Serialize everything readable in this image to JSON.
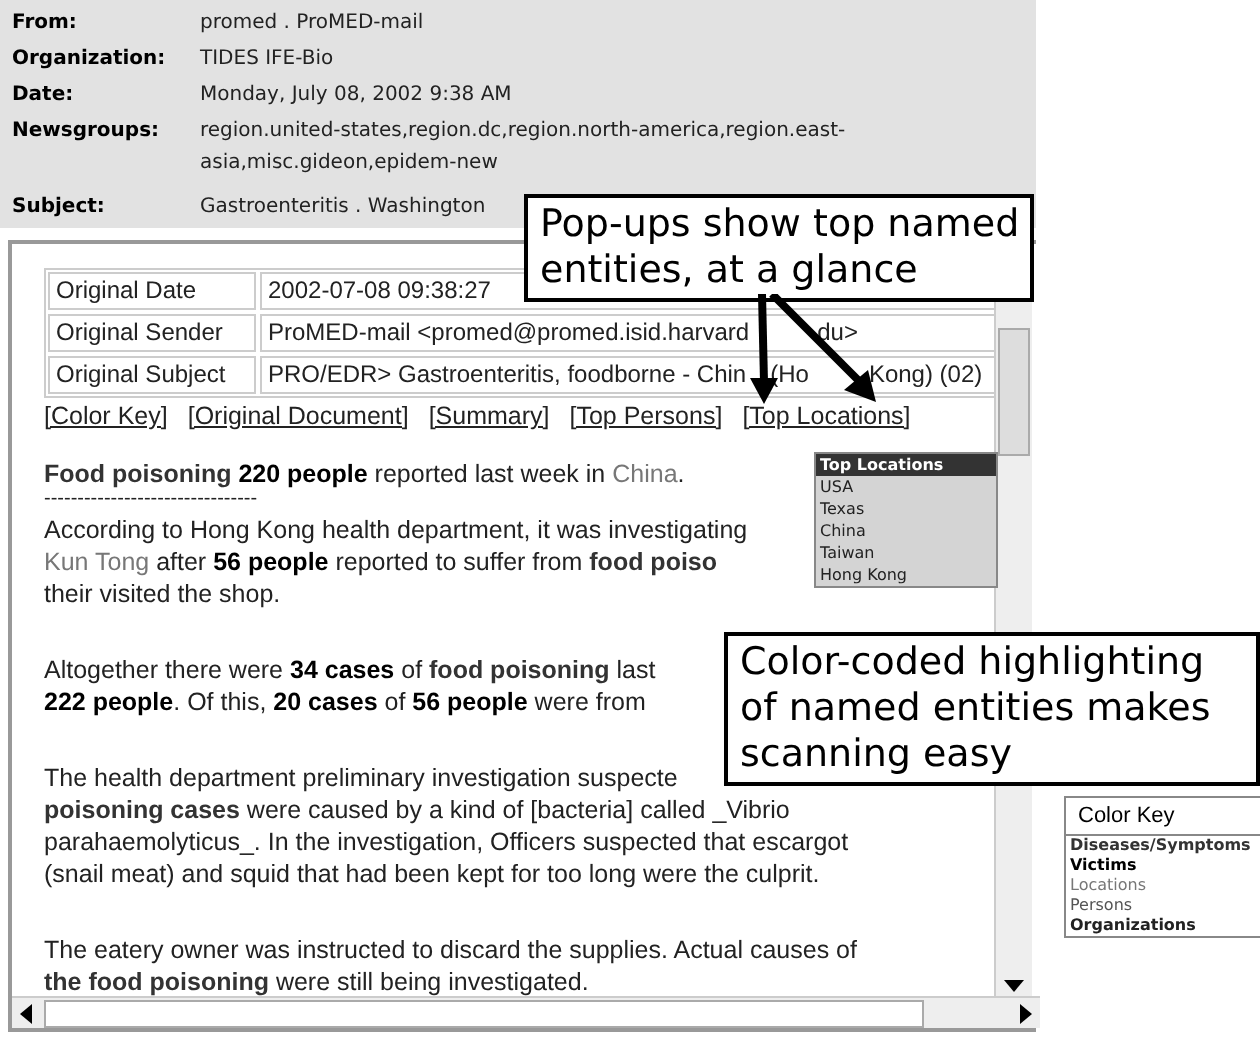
{
  "headers": [
    {
      "label": "From:",
      "lines": [
        "promed . ProMED-mail"
      ]
    },
    {
      "label": "Organization:",
      "lines": [
        "TIDES IFE-Bio"
      ]
    },
    {
      "label": "Date:",
      "lines": [
        "Monday, July 08, 2002 9:38 AM"
      ]
    },
    {
      "label": "Newsgroups:",
      "lines": [
        "region.united-states,region.dc,region.north-america,region.east-",
        "asia,misc.gideon,epidem-new"
      ]
    },
    {
      "label": "Subject:",
      "lines": [
        "Gastroenteritis . Washington"
      ]
    }
  ],
  "original_fields": [
    {
      "label": "Original Date",
      "value": [
        "2002-07-08 09:38:27"
      ]
    },
    {
      "label": "Original Sender",
      "value": [
        "ProMED-mail <promed@promed.isid.harvard",
        "du>"
      ]
    },
    {
      "label": "Original Subject",
      "value": [
        "PRO/EDR> Gastroenteritis, foodborne - Chin",
        "(Ho",
        "Kong) (02)"
      ]
    }
  ],
  "links": [
    "[Color Key]",
    "[Original Document]",
    "[Summary]",
    "[Top Persons]",
    "[Top Locations]"
  ],
  "headline": [
    {
      "text": "Food poisoning",
      "kind": "disease"
    },
    {
      "text": " 220 people",
      "kind": "victim"
    },
    {
      "text": " reported last week in "
    },
    {
      "text": "China",
      "kind": "location"
    },
    {
      "text": "."
    }
  ],
  "separator": "--------------------------------",
  "paragraphs": [
    [
      [
        {
          "text": "According to Hong Kong health department, it was investigating"
        }
      ],
      [
        {
          "text": "Kun Tong",
          "kind": "location"
        },
        {
          "text": " after "
        },
        {
          "text": "56 people",
          "kind": "victim"
        },
        {
          "text": " reported to suffer from "
        },
        {
          "text": "food poiso",
          "kind": "disease"
        }
      ],
      [
        {
          "text": "their visited the shop."
        }
      ]
    ],
    [
      [
        {
          "text": "Altogether there were "
        },
        {
          "text": "34 cases",
          "kind": "victim"
        },
        {
          "text": " of "
        },
        {
          "text": "food poisoning",
          "kind": "disease"
        },
        {
          "text": " last"
        }
      ],
      [
        {
          "text": "222 people",
          "kind": "victim"
        },
        {
          "text": ". Of this, "
        },
        {
          "text": "20 cases",
          "kind": "victim"
        },
        {
          "text": " of "
        },
        {
          "text": "56 people",
          "kind": "victim"
        },
        {
          "text": " were from"
        }
      ]
    ],
    [
      [
        {
          "text": "The health department preliminary investigation suspecte"
        }
      ],
      [
        {
          "text": "poisoning cases",
          "kind": "disease"
        },
        {
          "text": " were caused by a kind of [bacteria] called _Vibrio"
        }
      ],
      [
        {
          "text": "parahaemolyticus_. In the investigation, Officers suspected that escargot"
        }
      ],
      [
        {
          "text": "(snail meat) and squid that had been kept for too long were the culprit."
        }
      ]
    ],
    [
      [
        {
          "text": "The eatery owner was instructed to discard the supplies. Actual causes of"
        }
      ],
      [
        {
          "text": "the food poisoning",
          "kind": "disease"
        },
        {
          "text": " were still being investigated."
        }
      ]
    ]
  ],
  "top_locations_popup": {
    "title": "Top Locations",
    "items": [
      "USA",
      "Texas",
      "China",
      "Taiwan",
      "Hong Kong"
    ]
  },
  "callouts": [
    [
      "Pop-ups show top named",
      "entities, at a glance"
    ],
    [
      "Color-coded highlighting",
      "of named entities makes",
      "scanning easy"
    ]
  ],
  "color_key_popup": {
    "title": "Color Key",
    "items": [
      {
        "label": "Diseases/Symptoms",
        "kind": "disease"
      },
      {
        "label": "Victims",
        "kind": "victim"
      },
      {
        "label": "Locations",
        "kind": "location"
      },
      {
        "label": "Persons",
        "kind": "person"
      },
      {
        "label": "Organizations",
        "kind": "organization"
      }
    ]
  }
}
